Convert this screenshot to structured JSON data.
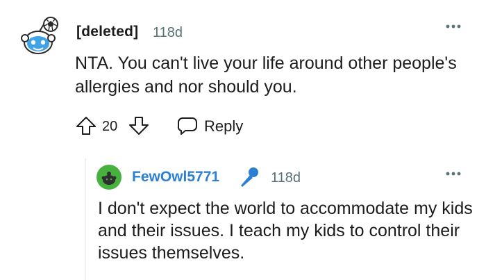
{
  "comment": {
    "author": "[deleted]",
    "time": "118d",
    "body": "NTA. You can't live your life around other people's allergies and nor should you.",
    "score": "20",
    "reply_label": "Reply",
    "avatar_icon": "snoo-deleted-avatar-icon"
  },
  "reply": {
    "author": "FewOwl5771",
    "time": "118d",
    "body": "I don't expect the world to accommodate my kids and their issues. I teach my kids to control their issues themselves.",
    "avatar_icon": "snoo-green-avatar-icon",
    "badge_icon": "microphone-icon"
  },
  "colors": {
    "author_link": "#2d7fd3",
    "muted": "#576f76",
    "avatar_green": "#46b13d",
    "mic_blue": "#2d7fd3",
    "text": "#1c1c1c"
  }
}
